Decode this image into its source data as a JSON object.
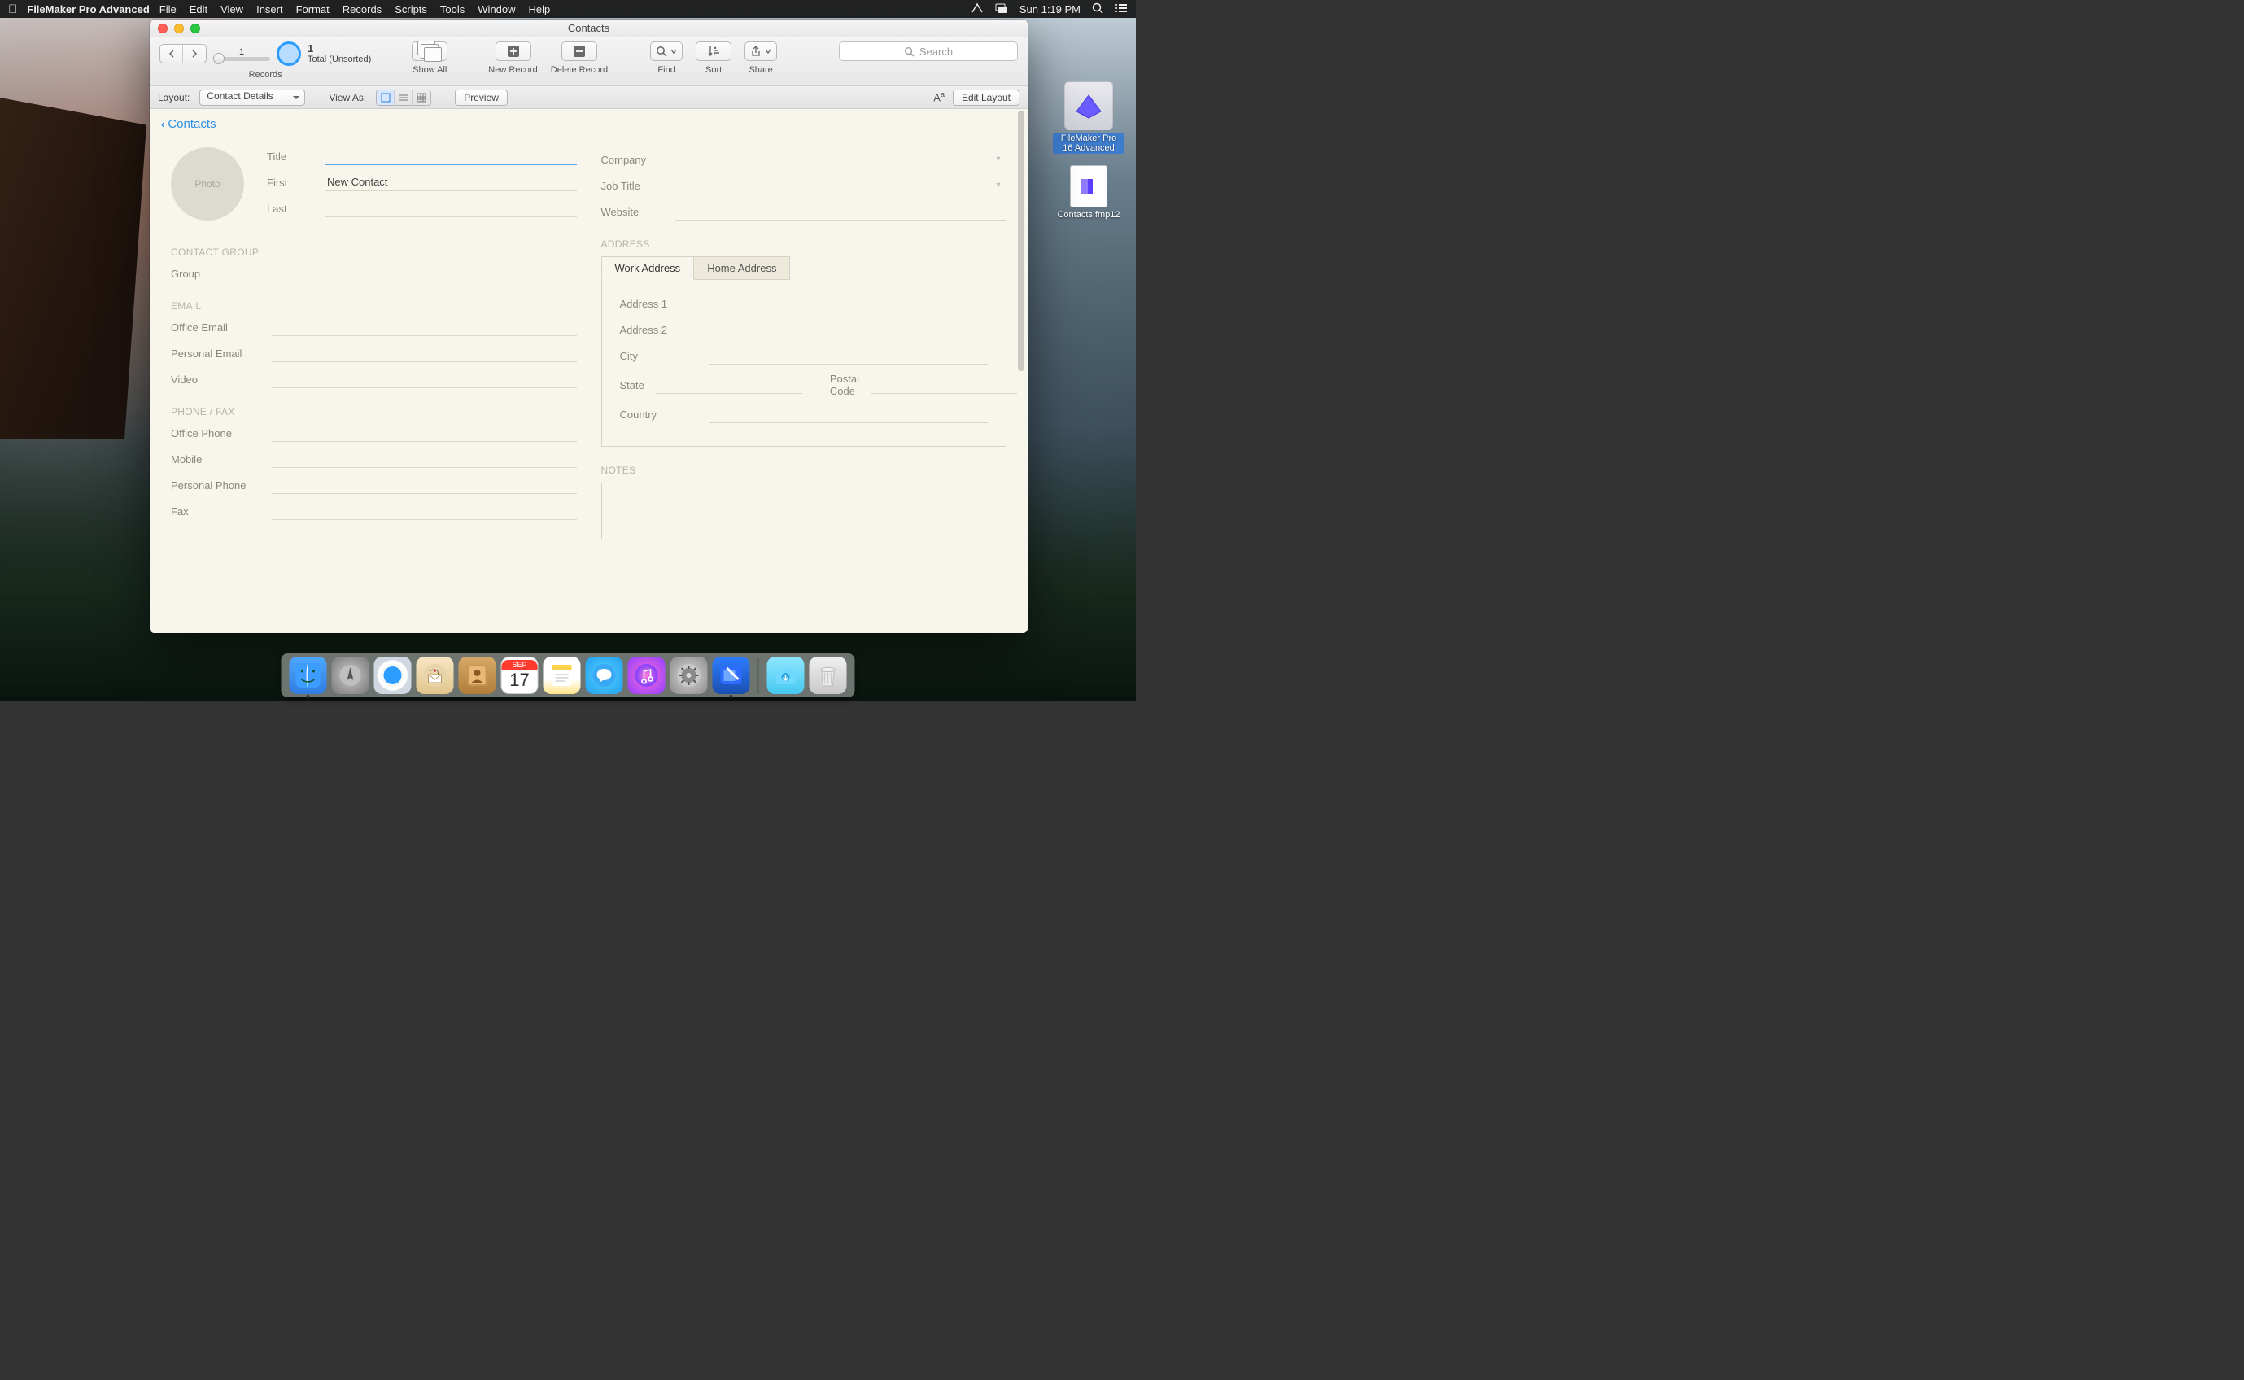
{
  "menubar": {
    "app_name": "FileMaker Pro Advanced",
    "menus": [
      "File",
      "Edit",
      "View",
      "Insert",
      "Format",
      "Records",
      "Scripts",
      "Tools",
      "Window",
      "Help"
    ],
    "clock": "Sun 1:19 PM"
  },
  "desktop_icons": {
    "0": {
      "label": "FileMaker Pro 16 Advanced"
    },
    "1": {
      "label": "Contacts.fmp12"
    }
  },
  "window": {
    "title": "Contacts",
    "toolbar": {
      "records_label": "Records",
      "record_index": "1",
      "totals_count": "1",
      "totals_text": "Total (Unsorted)",
      "show_all": "Show All",
      "new_record": "New Record",
      "delete_record": "Delete Record",
      "find": "Find",
      "sort": "Sort",
      "share": "Share",
      "search_placeholder": "Search"
    },
    "layoutbar": {
      "layout_label": "Layout:",
      "layout_value": "Contact Details",
      "view_as": "View As:",
      "preview": "Preview",
      "aa": "Aa",
      "edit_layout": "Edit Layout"
    }
  },
  "crumb": "Contacts",
  "form": {
    "photo_placeholder": "Photo",
    "labels": {
      "title": "Title",
      "first": "First",
      "last": "Last",
      "company": "Company",
      "job_title": "Job Title",
      "website": "Website",
      "contact_group_hdr": "CONTACT GROUP",
      "group": "Group",
      "email_hdr": "EMAIL",
      "office_email": "Office Email",
      "personal_email": "Personal Email",
      "video": "Video",
      "phone_hdr": "PHONE / FAX",
      "office_phone": "Office Phone",
      "mobile": "Mobile",
      "personal_phone": "Personal Phone",
      "fax": "Fax",
      "address_hdr": "ADDRESS",
      "tab_work": "Work Address",
      "tab_home": "Home Address",
      "address1": "Address 1",
      "address2": "Address 2",
      "city": "City",
      "state": "State",
      "postal": "Postal Code",
      "country": "Country",
      "notes_hdr": "NOTES"
    },
    "values": {
      "title": "",
      "first": "New Contact",
      "last": "",
      "company": "",
      "job_title": "",
      "website": ""
    }
  },
  "dock": {
    "cal_month": "SEP",
    "cal_day": "17"
  }
}
